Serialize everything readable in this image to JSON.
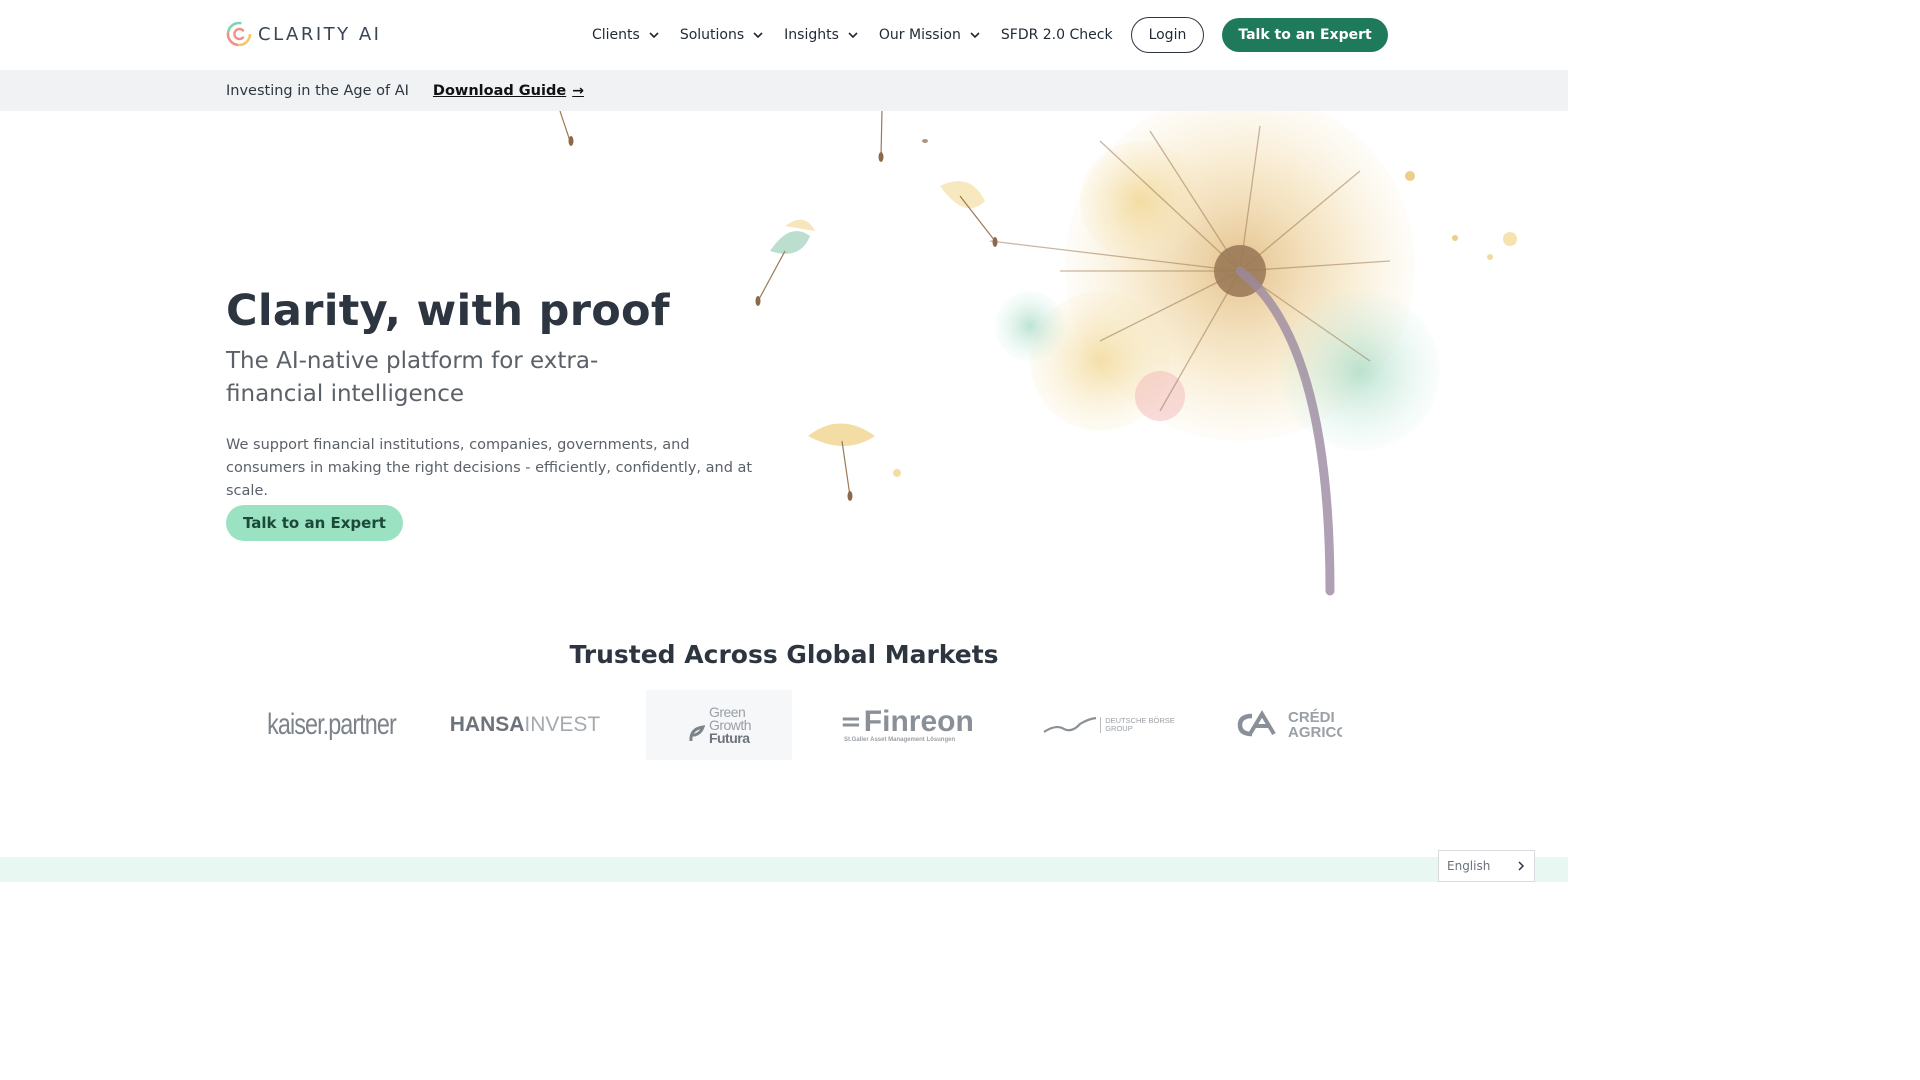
{
  "header": {
    "logo_text": "CLARITY AI",
    "nav": [
      {
        "label": "Clients",
        "dropdown": true
      },
      {
        "label": "Solutions",
        "dropdown": true
      },
      {
        "label": "Insights",
        "dropdown": true
      },
      {
        "label": "Our Mission",
        "dropdown": true
      },
      {
        "label": "SFDR 2.0 Check",
        "dropdown": false
      }
    ],
    "login_label": "Login",
    "cta_label": "Talk to an Expert"
  },
  "banner": {
    "text": "Investing in the Age of AI",
    "link_label": "Download Guide",
    "link_icon": "arrow-right-icon"
  },
  "hero": {
    "title": "Clarity, with proof",
    "subtitle": "The AI-native platform for extra-financial intelligence",
    "body": "We support financial institutions, companies, governments, and consumers in making the right decisions - efficiently, confidently, and at scale.",
    "cta_label": "Talk to an Expert",
    "art": "dandelion-watercolor-illustration"
  },
  "trusted": {
    "title": "Trusted Across Global Markets",
    "logos": [
      {
        "name": "kaiser.partner",
        "text": "kaiser.partner"
      },
      {
        "name": "hansainvest",
        "text_a": "HANSA",
        "text_b": "INVEST"
      },
      {
        "name": "green-growth-futura",
        "lines": [
          "Green",
          "Growth",
          "Futura"
        ]
      },
      {
        "name": "finreon",
        "text": "Finreon",
        "tagline": "St.Galler Asset Management Lösungen"
      },
      {
        "name": "deutsche-borse",
        "lines": [
          "DEUTSCHE BÖRSE",
          "GROUP"
        ]
      },
      {
        "name": "credit-agricole",
        "lines": [
          "CRÉDI",
          "AGRICO"
        ]
      }
    ]
  },
  "language": {
    "current": "English"
  },
  "colors": {
    "brand_green": "#1f7a5c",
    "mint": "#9be2c3",
    "text_dark": "#2d3640",
    "banner_bg": "#f1f2f4"
  }
}
